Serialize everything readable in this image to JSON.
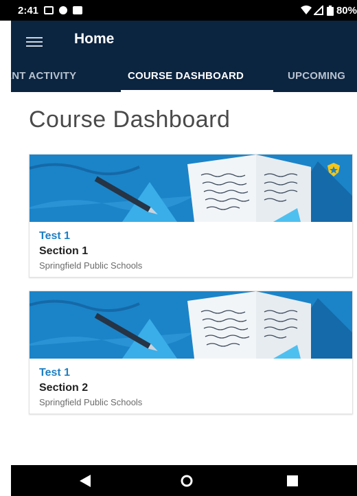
{
  "status_bar": {
    "time": "2:41",
    "battery": "80%"
  },
  "app_bar": {
    "title": "Home"
  },
  "tabs": [
    {
      "label": "CENT ACTIVITY",
      "selected": false
    },
    {
      "label": "COURSE DASHBOARD",
      "selected": true
    },
    {
      "label": "UPCOMING",
      "selected": false
    }
  ],
  "page": {
    "title": "Course Dashboard"
  },
  "courses": [
    {
      "name": "Test 1",
      "section": "Section 1",
      "school": "Springfield Public Schools",
      "badge": "shield-star-icon"
    },
    {
      "name": "Test 1",
      "section": "Section 2",
      "school": "Springfield Public Schools"
    }
  ],
  "colors": {
    "app_bar": "#0b2440",
    "banner_blue": "#1b84c8",
    "course_link": "#1d7fc4",
    "badge_yellow": "#f5c518"
  }
}
